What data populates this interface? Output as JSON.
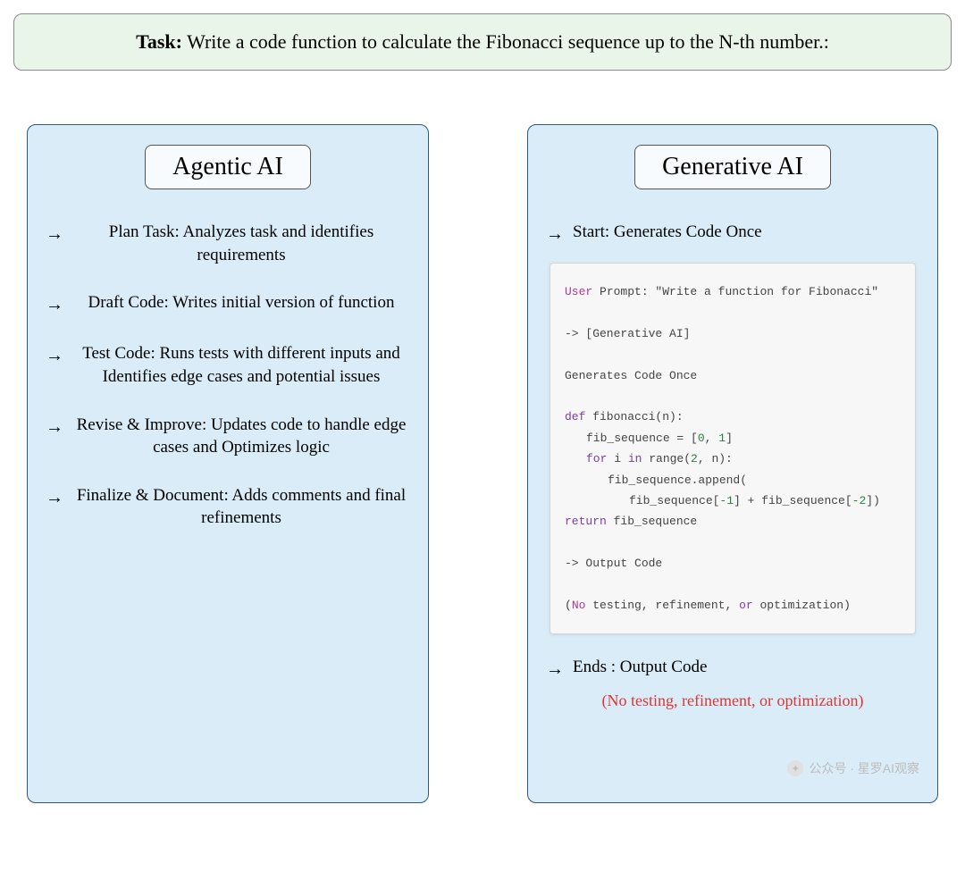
{
  "task": {
    "label": "Task:",
    "text": "Write a code function to calculate the Fibonacci sequence up to the N-th number.:"
  },
  "left": {
    "title": "Agentic AI",
    "steps": [
      "Plan Task: Analyzes task and identifies requirements",
      "Draft Code: Writes initial version of function",
      "Test Code:  Runs tests with different inputs and Identifies edge cases and potential issues",
      "Revise & Improve: Updates code to handle edge cases  and Optimizes logic",
      "Finalize & Document: Adds comments and final refinements"
    ]
  },
  "right": {
    "title": "Generative AI",
    "start": "Start: Generates Code Once",
    "ends": "Ends : Output Code",
    "note": "(No testing, refinement, or optimization)",
    "code": {
      "l1_user": "User",
      "l1_rest": " Prompt: \"Write a function for Fibonacci\"",
      "l2": "-> [Generative AI]",
      "l3": "Generates Code Once",
      "l4_def": "def",
      "l4_rest": " fibonacci(n):",
      "l5a": "fib_sequence = [",
      "l5b": "0",
      "l5c": ", ",
      "l5d": "1",
      "l5e": "]",
      "l6_for": "for",
      "l6a": " i ",
      "l6_in": "in",
      "l6b": " range(",
      "l6n": "2",
      "l6c": ", n):",
      "l7": "fib_sequence.append(",
      "l8a": "fib_sequence[",
      "l8n1": "-1",
      "l8b": "] + fib_sequence[",
      "l8n2": "-2",
      "l8c": "])",
      "l9_ret": "return",
      "l9a": " fib_sequence",
      "l10": "-> Output Code",
      "l11a": "(",
      "l11_no": "No",
      "l11b": " testing, refinement, ",
      "l11_or": "or",
      "l11c": " optimization)"
    }
  },
  "watermark": "公众号 · 星罗AI观察"
}
